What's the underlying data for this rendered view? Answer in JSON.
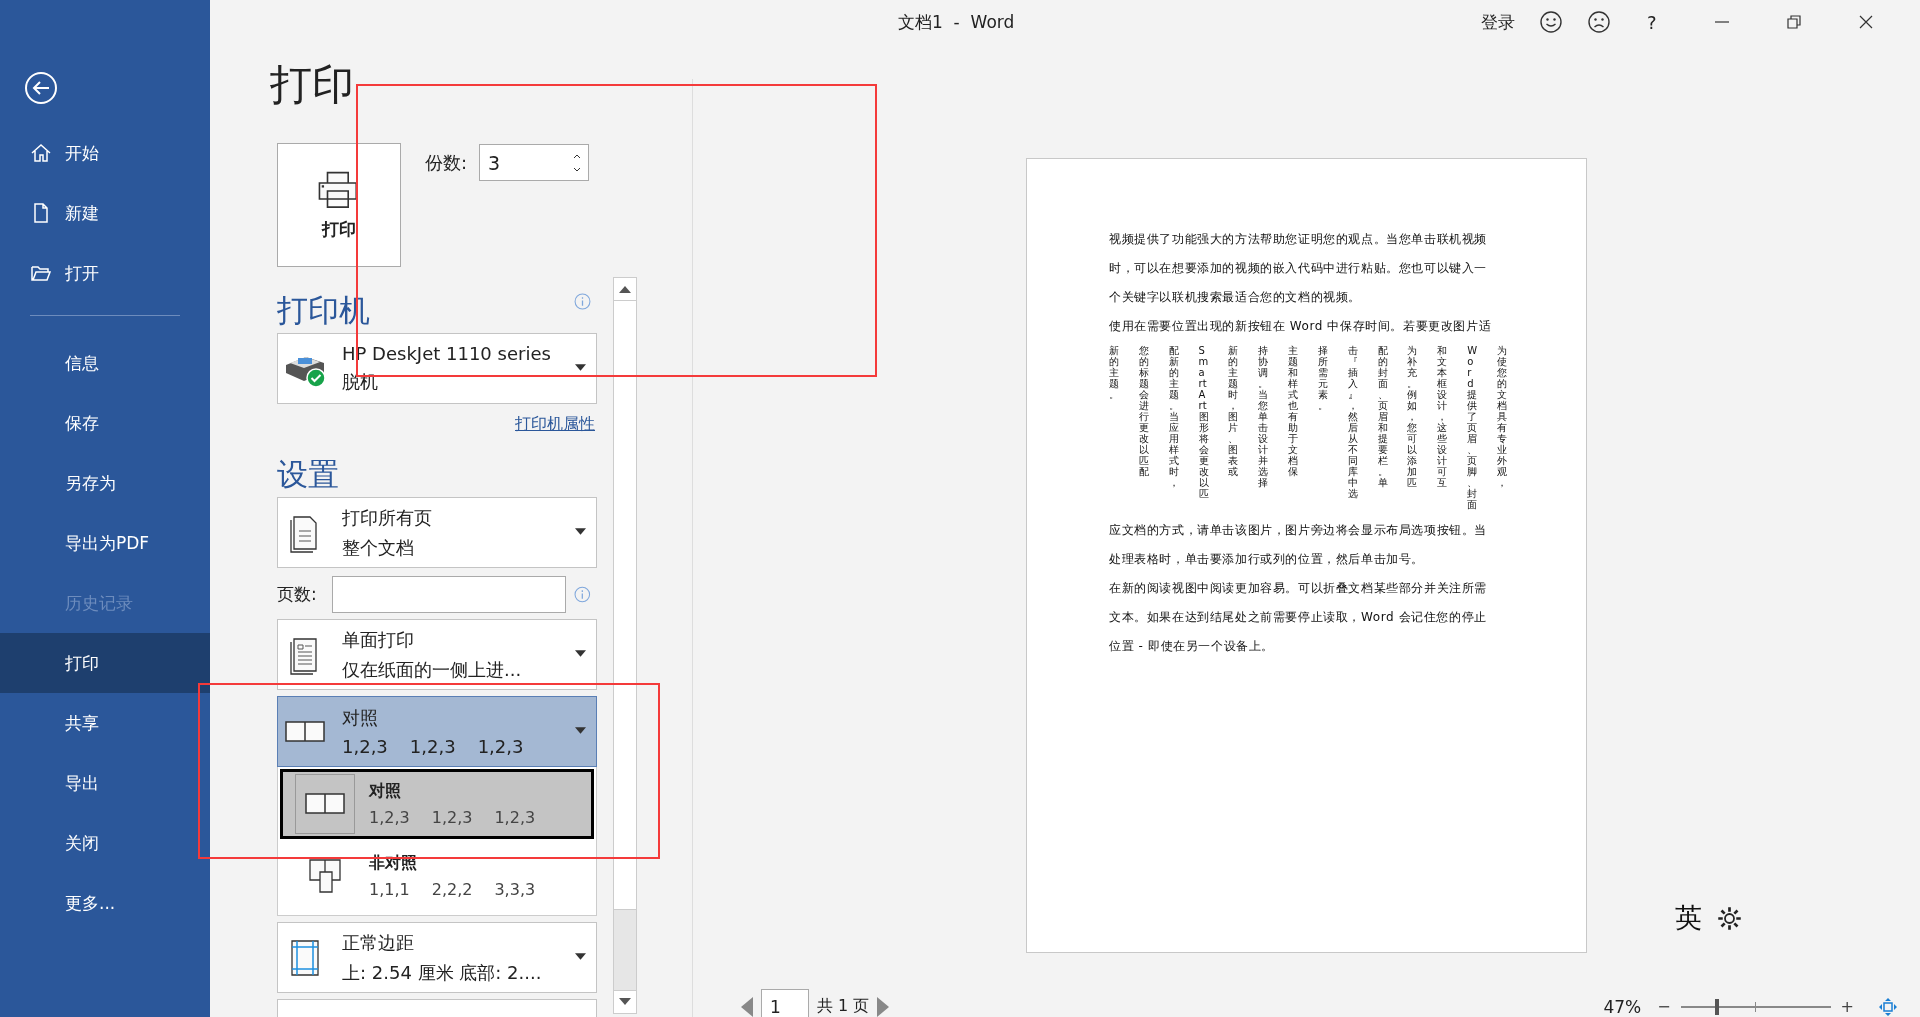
{
  "window": {
    "title": "文档1  -  Word",
    "account": "登录",
    "help": "?"
  },
  "sidebar": {
    "top_items": [
      {
        "label": "开始",
        "kind": "home",
        "selected": false,
        "disabled": false
      },
      {
        "label": "新建",
        "kind": "new",
        "selected": false,
        "disabled": false
      },
      {
        "label": "打开",
        "kind": "open",
        "selected": false,
        "disabled": false
      }
    ],
    "items": [
      {
        "label": "信息",
        "selected": false,
        "disabled": false
      },
      {
        "label": "保存",
        "selected": false,
        "disabled": false
      },
      {
        "label": "另存为",
        "selected": false,
        "disabled": false
      },
      {
        "label": "导出为PDF",
        "selected": false,
        "disabled": false
      },
      {
        "label": "历史记录",
        "selected": false,
        "disabled": true
      },
      {
        "label": "打印",
        "selected": true,
        "disabled": false
      },
      {
        "label": "共享",
        "selected": false,
        "disabled": false
      },
      {
        "label": "导出",
        "selected": false,
        "disabled": false
      },
      {
        "label": "关闭",
        "selected": false,
        "disabled": false
      },
      {
        "label": "更多...",
        "selected": false,
        "disabled": false
      }
    ]
  },
  "page_title": "打印",
  "print_button": {
    "label": "打印"
  },
  "copies": {
    "label": "份数:",
    "value": "3"
  },
  "printer": {
    "heading": "打印机",
    "name": "HP DeskJet 1110 series",
    "status": "脱机",
    "properties_link": "打印机属性"
  },
  "settings": {
    "heading": "设置",
    "items": [
      {
        "kind": "pages",
        "title": "打印所有页",
        "subtitle": "整个文档",
        "expanded": false
      },
      {
        "kind": "field",
        "label": "页数:"
      },
      {
        "kind": "sides",
        "title": "单面打印",
        "subtitle": "仅在纸面的一侧上进...",
        "expanded": false
      },
      {
        "kind": "collation",
        "title": "对照",
        "sequences": [
          "1,2,3",
          "1,2,3",
          "1,2,3"
        ],
        "expanded": true,
        "options": [
          {
            "kind": "collated",
            "title": "对照",
            "sequences": [
              "1,2,3",
              "1,2,3",
              "1,2,3"
            ],
            "selected": true
          },
          {
            "kind": "uncollated",
            "title": "非对照",
            "sequences": [
              "1,1,1",
              "2,2,2",
              "3,3,3"
            ],
            "selected": false
          }
        ]
      },
      {
        "kind": "margins",
        "title": "正常边距",
        "subtitle": "上: 2.54 厘米 底部: 2....",
        "expanded": false
      }
    ]
  },
  "document": {
    "blocks": [
      {
        "kind": "lines",
        "lines": [
          "视频提供了功能强大的方法帮助您证明您的观点。当您单击联机视频",
          "时，可以在想要添加的视频的嵌入代码中进行粘贴。您也可以键入一",
          "个关键字以联机搜索最适合您的文档的视频。"
        ]
      },
      {
        "kind": "lines",
        "lines": [
          "使用在需要位置出现的新按钮在 Word 中保存时间。若要更改图片适"
        ]
      },
      {
        "kind": "vertical",
        "columns": [
          "新的主题。",
          "您的标题会进行更改以匹配",
          "配新的主题。当应用样式时，",
          "SmartArt 图形将会更改以匹",
          "新的主题时，图片、图表或",
          "持协调。当您单击设计并选择",
          "主题和样式也有助于文档保",
          "择所需元素。",
          "击『插入』，然后从不同库中选",
          "配的封面、页眉和提要栏。单",
          "为补充。例如，您可以添加匹",
          "和文本框设计，这些设计可互",
          "Word 提供了页眉、页脚、封面",
          "为使您的文档具有专业外观，"
        ]
      },
      {
        "kind": "lines",
        "lines": [
          "应文档的方式，请单击该图片，图片旁边将会显示布局选项按钮。当",
          "处理表格时，单击要添加行或列的位置，然后单击加号。"
        ]
      },
      {
        "kind": "lines",
        "lines": [
          "在新的阅读视图中阅读更加容易。可以折叠文档某些部分并关注所需",
          "文本。如果在达到结尾处之前需要停止读取，Word 会记住您的停止",
          "位置 - 即使在另一个设备上。"
        ]
      }
    ]
  },
  "page_nav": {
    "page": "1",
    "total": "共 1 页"
  },
  "zoom": {
    "reading": "47%",
    "minus": "−",
    "plus": "+",
    "level": 0.23
  },
  "ime": {
    "language": "英"
  }
}
